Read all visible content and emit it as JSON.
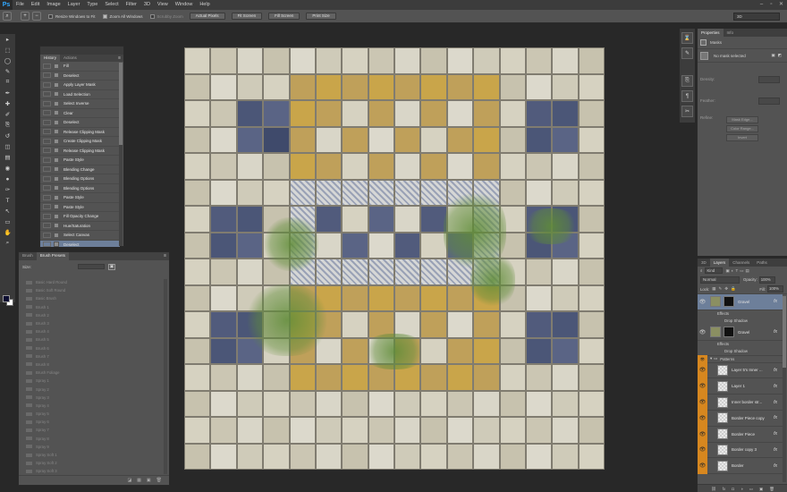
{
  "app": {
    "logo": "Ps"
  },
  "menu": [
    "File",
    "Edit",
    "Image",
    "Layer",
    "Type",
    "Select",
    "Filter",
    "3D",
    "View",
    "Window",
    "Help"
  ],
  "window_controls": [
    "minimize-icon",
    "maximize-icon",
    "close-icon"
  ],
  "options_bar": {
    "resize_windows_label": "Resize Windows to Fit",
    "zoom_all_label": "Zoom All Windows",
    "scrubby_label": "Scrubby Zoom",
    "buttons": [
      "Actual Pixels",
      "Fit Screen",
      "Fill Screen",
      "Print Size"
    ],
    "workspace": "3D"
  },
  "tools": [
    "move-icon",
    "marquee-icon",
    "lasso-icon",
    "quick-select-icon",
    "crop-icon",
    "eyedropper-icon",
    "healing-icon",
    "brush-icon",
    "stamp-icon",
    "history-brush-icon",
    "eraser-icon",
    "gradient-icon",
    "blur-icon",
    "dodge-icon",
    "pen-icon",
    "type-icon",
    "path-select-icon",
    "shape-icon",
    "hand-icon",
    "zoom-icon"
  ],
  "tool_glyphs": [
    "▸",
    "⬚",
    "◯",
    "✎",
    "⌗",
    "✒",
    "✚",
    "✐",
    "⎘",
    "↺",
    "◫",
    "▤",
    "◉",
    "●",
    "✑",
    "T",
    "↖",
    "▭",
    "✋",
    "⌕"
  ],
  "colors": {
    "foreground": "#0c0d31",
    "background": "#ffffff",
    "selection": "#6d7f9a",
    "layer_group": "#d7871f"
  },
  "history_panel": {
    "tabs": [
      "History",
      "Actions"
    ],
    "items": [
      "Fill",
      "Deselect",
      "Apply Layer Mask",
      "Load Selection",
      "Select Inverse",
      "Clear",
      "Deselect",
      "Release Clipping Mask",
      "Create Clipping Mask",
      "Release Clipping Mask",
      "Paste Style",
      "Blending Change",
      "Blending Options",
      "Blending Options",
      "Paste Style",
      "Paste Style",
      "Fill Opacity Change",
      "Hue/Saturation",
      "Select Canvas",
      "Deselect"
    ]
  },
  "brush_panel": {
    "tabs": [
      "Brush",
      "Brush Presets"
    ],
    "size_label": "Size:",
    "presets": [
      "Basic Hard Round",
      "Basic Soft Round",
      "Basic Brush",
      "Brush 1",
      "Brush 2",
      "Brush 3",
      "Brush 4",
      "Brush 5",
      "Brush 6",
      "Brush 7",
      "Brush 8",
      "Brush Foliage",
      "Spray 1",
      "Spray 2",
      "Spray 3",
      "Spray 4",
      "Spray 5",
      "Spray 6",
      "Spray 7",
      "Spray 8",
      "Spray 9",
      "Spray Soft 1",
      "Spray Soft 2",
      "Spray Soft 3"
    ]
  },
  "properties_panel": {
    "tabs": [
      "Properties",
      "Info"
    ],
    "section": "Masks",
    "mask_status": "No mask selected",
    "density_label": "Density:",
    "feather_label": "Feather:",
    "refine_label": "Refine:",
    "buttons": [
      "Mask Edge...",
      "Color Range...",
      "Invert"
    ]
  },
  "layers_panel": {
    "tabs": [
      "3D",
      "Layers",
      "Channels",
      "Paths"
    ],
    "kind_label": "Kind",
    "blend_mode": "Normal",
    "opacity_label": "Opacity:",
    "opacity_value": "100%",
    "lock_label": "Lock:",
    "fill_label": "Fill:",
    "fill_value": "100%",
    "layers": [
      {
        "name": "Gravel",
        "effects": [
          "Effects",
          "Drop Shadow"
        ],
        "fx": "fx",
        "dark_thumb": true,
        "selected": true
      },
      {
        "name": "Gravel",
        "effects": [
          "Effects",
          "Drop Shadow"
        ],
        "fx": "fx",
        "dark_thumb": true,
        "selected": false
      }
    ],
    "group": {
      "name": "Patterns"
    },
    "group_layers": [
      "Layer 5's Inner ...",
      "Layer 1",
      "Inner border str...",
      "Border Piece copy",
      "Border Piece",
      "Border copy 3",
      "Border"
    ],
    "group_fx": "fx"
  }
}
